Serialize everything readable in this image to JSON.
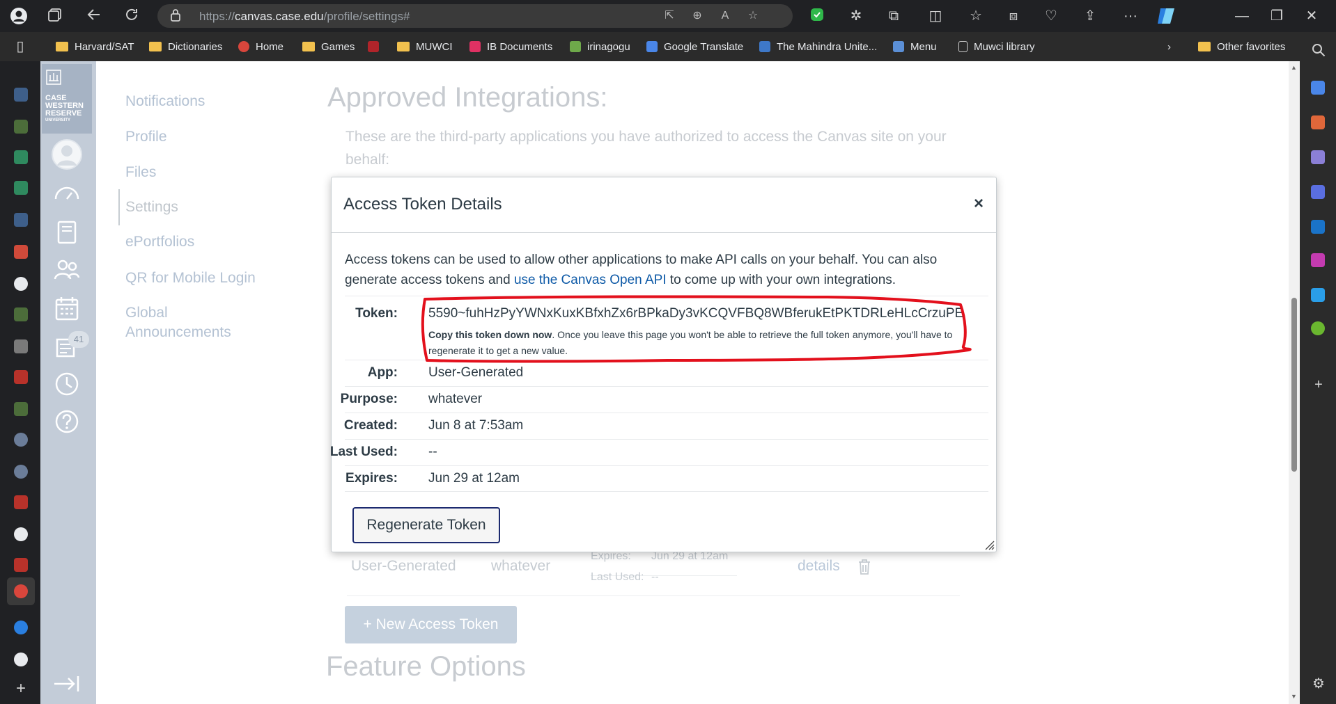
{
  "browser": {
    "url_scheme": "https://",
    "url_host": "canvas.case.edu",
    "url_path": "/profile/settings#",
    "bookmarks": [
      {
        "label": "Harvard/SAT",
        "type": "folder"
      },
      {
        "label": "Dictionaries",
        "type": "folder"
      },
      {
        "label": "Home",
        "type": "site",
        "color": "#d9463c"
      },
      {
        "label": "Games",
        "type": "folder"
      },
      {
        "label": "",
        "type": "site",
        "color": "#b0242a"
      },
      {
        "label": "MUWCI",
        "type": "folder"
      },
      {
        "label": "IB Documents",
        "type": "site",
        "color": "#e03163"
      },
      {
        "label": "irinagogu",
        "type": "site",
        "color": "#6ea94a"
      },
      {
        "label": "Google Translate",
        "type": "site",
        "color": "#4a86e8"
      },
      {
        "label": "The Mahindra Unite...",
        "type": "site",
        "color": "#3e78c8"
      },
      {
        "label": "Menu",
        "type": "site",
        "color": "#5b8fd6"
      },
      {
        "label": "Muwci library",
        "type": "page"
      }
    ],
    "other_favorites": "Other favorites"
  },
  "canvas_nav": {
    "logo_lines": [
      "CASE",
      "WESTERN",
      "RESERVE",
      "UNIVERSITY"
    ],
    "inbox_badge": "41"
  },
  "settings_nav": {
    "items": [
      "Notifications",
      "Profile",
      "Files",
      "Settings",
      "ePortfolios",
      "QR for Mobile Login",
      "Global Announcements"
    ],
    "global_line1": "Global",
    "global_line2": "Announcements",
    "active": "Settings"
  },
  "background": {
    "title": "Approved Integrations:",
    "desc": "These are the third-party applications you have authorized to access the Canvas site on your behalf:",
    "row_app": "User-Generated",
    "row_purpose": "whatever",
    "row_expires_label": "Expires:",
    "row_expires_value": "Jun 29 at 12am",
    "row_lastused_label": "Last Used:",
    "row_lastused_value": "--",
    "row_details": "details",
    "new_token_button": "+ New Access Token",
    "feature_title": "Feature Options"
  },
  "modal": {
    "title": "Access Token Details",
    "close": "×",
    "intro_part1": "Access tokens can be used to allow other applications to make API calls on your behalf. You can also generate access tokens and ",
    "intro_link": "use the Canvas Open API",
    "intro_part2": " to come up with your own integrations.",
    "token_label": "Token:",
    "token_value": "5590~fuhHzPyYWNxKuxKBfxhZx6rBPkaDy3vKCQVFBQ8WBferukEtPKTDRLeHLcCrzuPE",
    "token_note_bold": "Copy this token down now",
    "token_note_rest": ". Once you leave this page you won't be able to retrieve the full token anymore, you'll have to regenerate it to get a new value.",
    "app_label": "App:",
    "app_value": "User-Generated",
    "purpose_label": "Purpose:",
    "purpose_value": "whatever",
    "created_label": "Created:",
    "created_value": "Jun 8 at 7:53am",
    "lastused_label": "Last Used:",
    "lastused_value": "--",
    "expires_label": "Expires:",
    "expires_value": "Jun 29 at 12am",
    "regenerate_button": "Regenerate Token"
  },
  "colors": {
    "annotation": "#e3101c",
    "canvas_nav": "#c3ccd8",
    "link": "#0e5aa7",
    "button_border": "#1c2a6f"
  }
}
